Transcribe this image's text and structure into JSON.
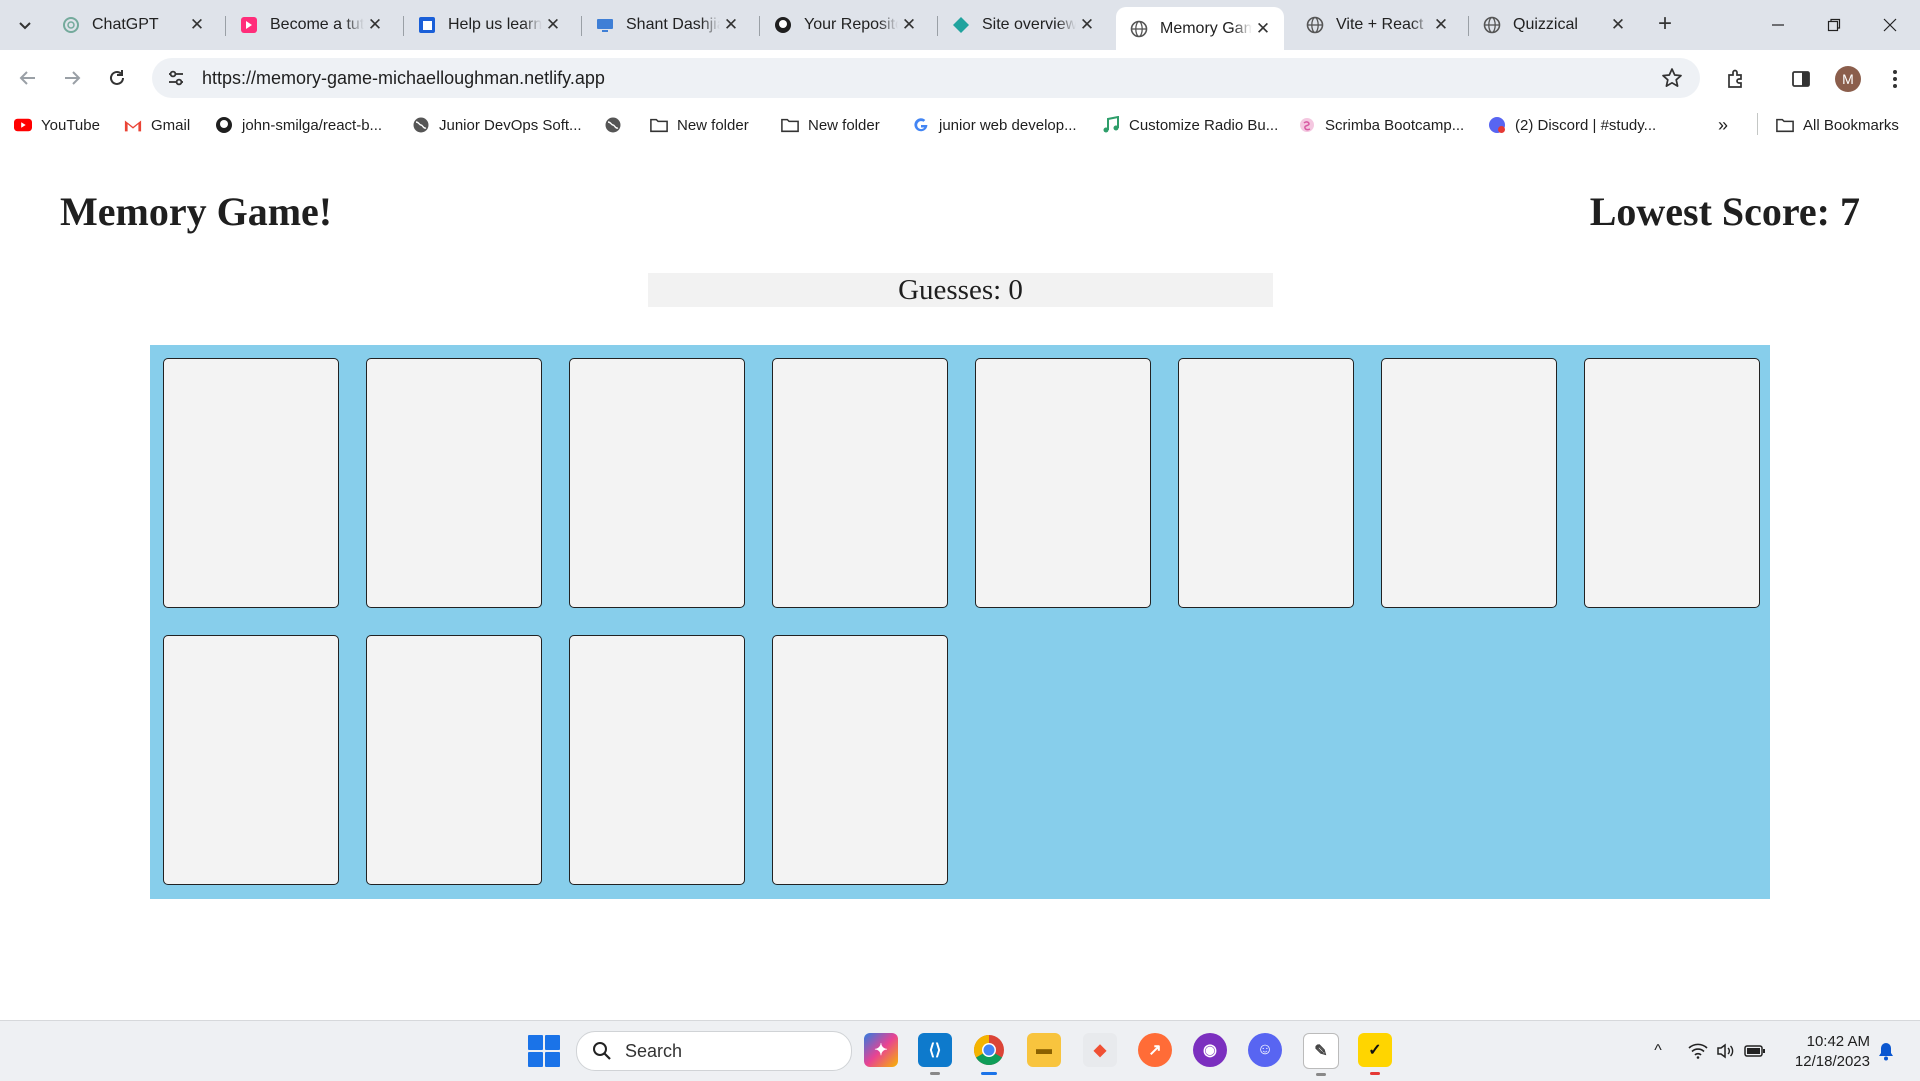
{
  "browser": {
    "tabs": [
      {
        "title": "ChatGPT",
        "icon": "chatgpt-icon",
        "active": false
      },
      {
        "title": "Become a tut",
        "icon": "preply-icon",
        "active": false
      },
      {
        "title": "Help us learn",
        "icon": "form-icon",
        "active": false
      },
      {
        "title": "Shant Dashjia",
        "icon": "monitor-icon",
        "active": false
      },
      {
        "title": "Your Reposito",
        "icon": "github-icon",
        "active": false
      },
      {
        "title": "Site overview",
        "icon": "netlify-icon",
        "active": false
      },
      {
        "title": "Memory Gam",
        "icon": "globe-icon",
        "active": true
      },
      {
        "title": "Vite + React",
        "icon": "globe-icon",
        "active": false
      },
      {
        "title": "Quizzical",
        "icon": "globe-icon",
        "active": false
      }
    ],
    "url": "https://memory-game-michaelloughman.netlify.app",
    "profile_initial": "M",
    "bookmarks": [
      {
        "label": "YouTube",
        "icon": "youtube-icon"
      },
      {
        "label": "Gmail",
        "icon": "gmail-icon"
      },
      {
        "label": "john-smilga/react-b...",
        "icon": "github-icon"
      },
      {
        "label": "Junior DevOps Soft...",
        "icon": "globe-icon"
      },
      {
        "label": "",
        "icon": "globe-icon"
      },
      {
        "label": "New folder",
        "icon": "folder-icon"
      },
      {
        "label": "New folder",
        "icon": "folder-icon"
      },
      {
        "label": "junior web develop...",
        "icon": "google-icon"
      },
      {
        "label": "Customize Radio Bu...",
        "icon": "music-icon"
      },
      {
        "label": "Scrimba Bootcamp...",
        "icon": "scrimba-icon"
      },
      {
        "label": "(2) Discord | #study...",
        "icon": "discord-icon"
      }
    ],
    "all_bookmarks": "All Bookmarks"
  },
  "game": {
    "title": "Memory Game!",
    "lowest_score": "Lowest Score: 7",
    "guesses": "Guesses: 0",
    "card_count": 12,
    "board_color": "#87ceeb",
    "card_color": "#f3f3f3"
  },
  "taskbar": {
    "search_placeholder": "Search",
    "apps": [
      "copilot-icon",
      "vscode-icon",
      "chrome-icon",
      "file-explorer-icon",
      "git-icon",
      "postman-icon",
      "github-desktop-icon",
      "discord-icon",
      "notepad-icon",
      "norton-icon"
    ],
    "time": "10:42 AM",
    "date": "12/18/2023"
  }
}
